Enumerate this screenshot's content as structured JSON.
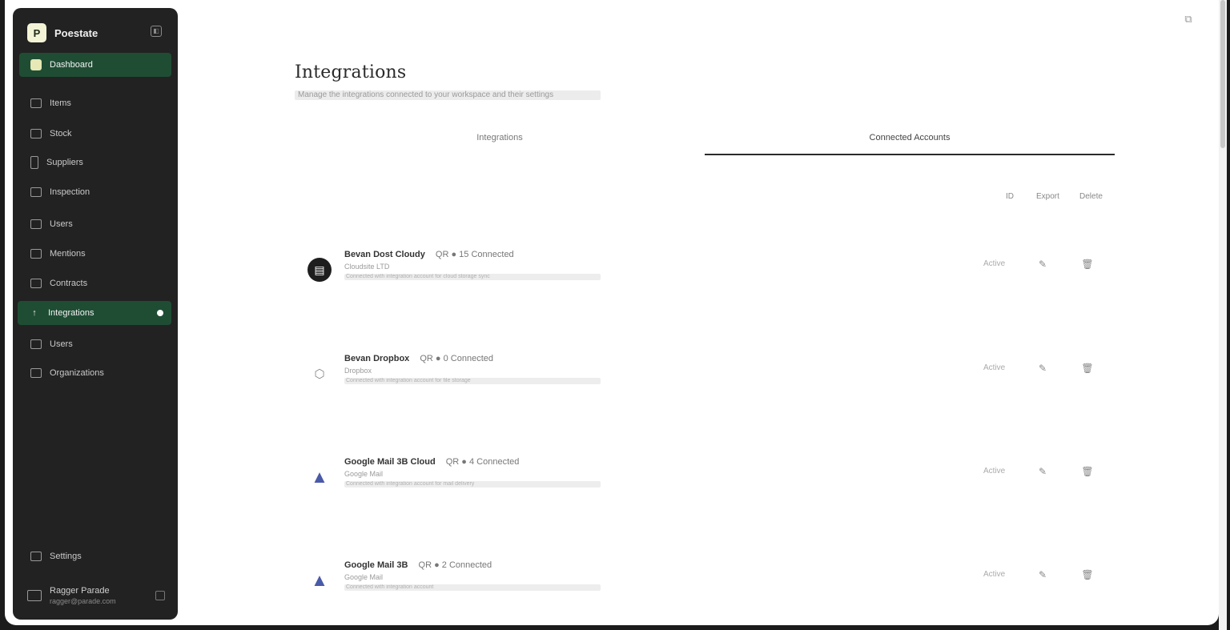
{
  "sidebar": {
    "brand": "Poestate",
    "brand_logo_letter": "P",
    "items": [
      {
        "label": "Dashboard"
      },
      {
        "label": "Items"
      },
      {
        "label": "Stock"
      },
      {
        "label": "Suppliers"
      },
      {
        "label": "Inspection"
      },
      {
        "label": "Users"
      },
      {
        "label": "Mentions"
      },
      {
        "label": "Contracts"
      },
      {
        "label": "Integrations"
      },
      {
        "label": "Users"
      },
      {
        "label": "Organizations"
      },
      {
        "label": "Settings"
      }
    ],
    "user": {
      "name": "Ragger Parade",
      "email": "ragger@parade.com"
    }
  },
  "main": {
    "title": "Integrations",
    "subtitle": "Manage the integrations connected to your workspace and their settings",
    "tabs": [
      {
        "label": "Integrations"
      },
      {
        "label": "Connected Accounts"
      }
    ],
    "columns": {
      "status": "ID",
      "edit": "Export",
      "delete": "Delete"
    },
    "rows": [
      {
        "name": "Bevan Dost Cloudy",
        "meta": "QR ● 15 Connected",
        "desc": "Cloudsite LTD",
        "bar": "Connected with integration account for cloud storage sync",
        "status": "Active"
      },
      {
        "name": "Bevan Dropbox",
        "meta": "QR ● 0 Connected",
        "desc": "Dropbox",
        "bar": "Connected with integration account for file storage",
        "status": "Active"
      },
      {
        "name": "Google Mail 3B Cloud",
        "meta": "QR ● 4 Connected",
        "desc": "Google Mail",
        "bar": "Connected with integration account for mail delivery",
        "status": "Active"
      },
      {
        "name": "Google Mail 3B",
        "meta": "QR ● 2 Connected",
        "desc": "Google Mail",
        "bar": "Connected with integration account",
        "status": "Active"
      }
    ]
  },
  "colors": {
    "sidebar_bg": "#222222",
    "active_green": "#1f4d34",
    "page_bg": "#ffffff"
  },
  "icons": {
    "collapse": "sidebar-collapse-icon",
    "settings": "settings-icon",
    "edit": "pencil-icon",
    "delete": "trash-icon",
    "top_right": "window-icon"
  }
}
